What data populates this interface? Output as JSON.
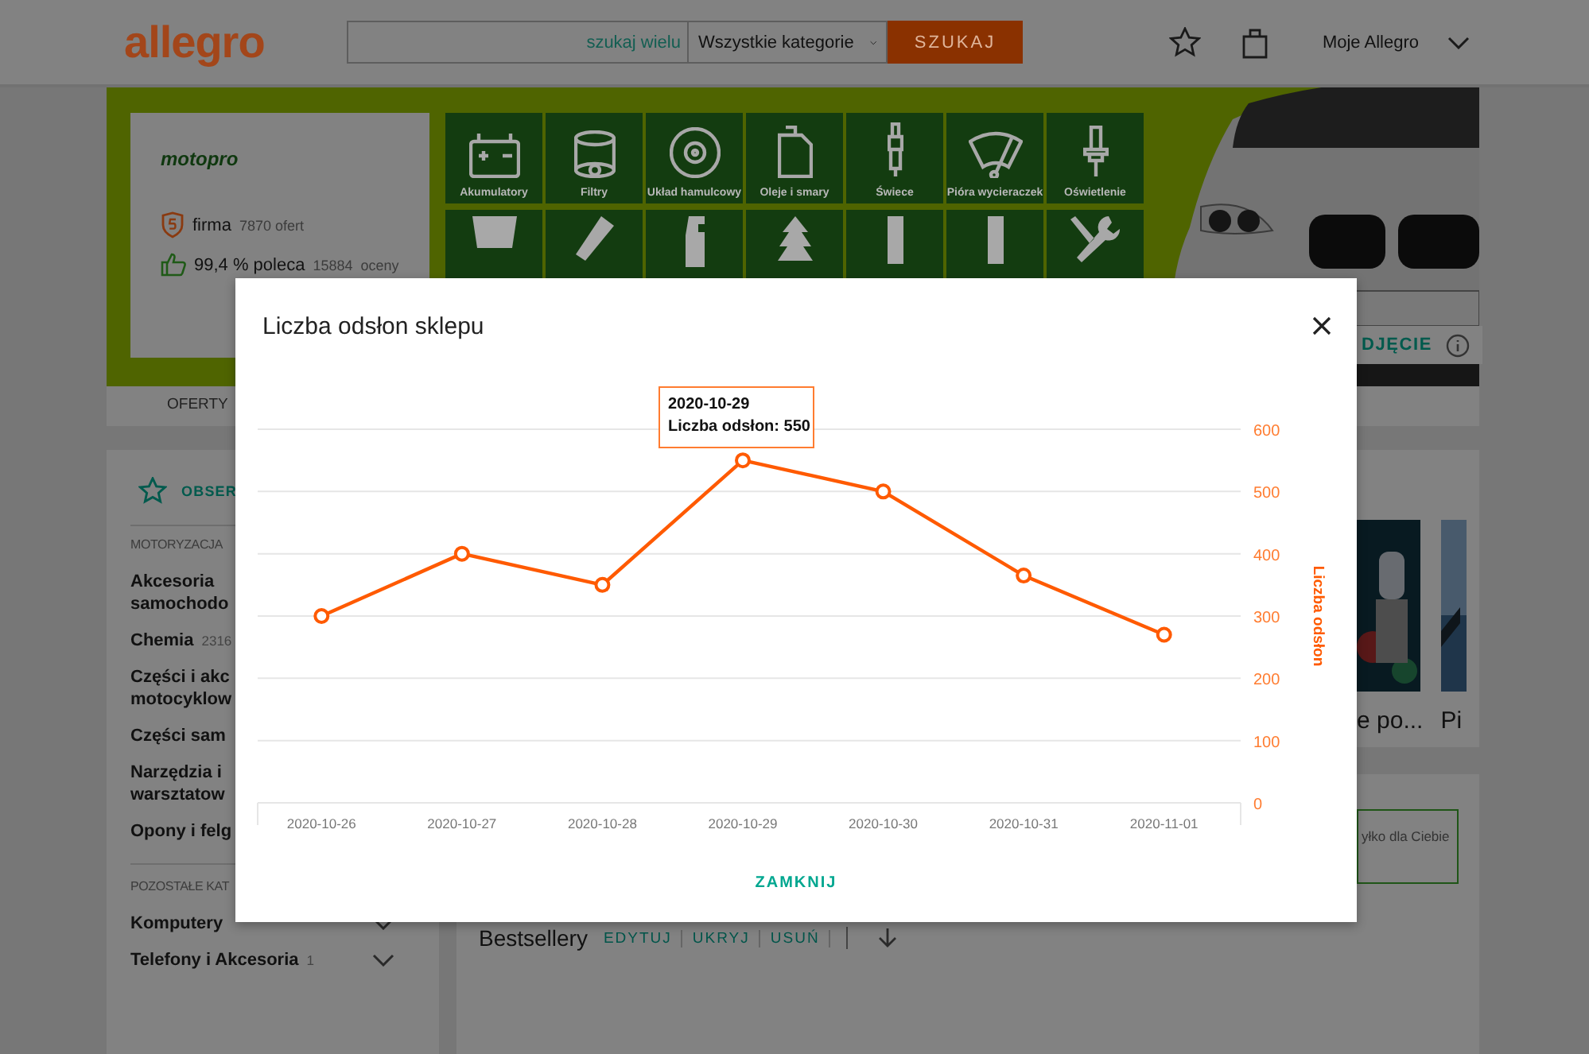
{
  "header": {
    "logo": "allegro",
    "search_link": "szukaj wielu",
    "category": "Wszystkie kategorie",
    "search_button": "SZUKAJ",
    "account": "Moje Allegro"
  },
  "shop": {
    "logo": "motopro",
    "type": "firma",
    "offers": "7870 ofert",
    "rating": "99,4 % poleca",
    "ratings_count": "15884",
    "ratings_label": "oceny",
    "photo_button": "DJĘCIE"
  },
  "categories": [
    {
      "label": "Akumulatory"
    },
    {
      "label": "Filtry"
    },
    {
      "label": "Układ hamulcowy"
    },
    {
      "label": "Oleje i smary"
    },
    {
      "label": "Świece"
    },
    {
      "label": "Pióra wycieraczek"
    },
    {
      "label": "Oświetlenie"
    }
  ],
  "tabs": [
    {
      "label": "OFERTY",
      "selected": false
    }
  ],
  "sidebar": {
    "follow": "OBSER",
    "groups": [
      {
        "heading": "MOTORYZACJA",
        "items": [
          {
            "label": "Akcesoria\nsamochodo"
          },
          {
            "label": "Chemia",
            "count": "2316"
          },
          {
            "label": "Części i akc\nmotocyklow"
          },
          {
            "label": "Części sam"
          },
          {
            "label": "Narzędzia i\nwarsztatow"
          },
          {
            "label": "Opony i felg"
          }
        ]
      },
      {
        "heading": "POZOSTAŁE KAT",
        "items": [
          {
            "label": "Komputery",
            "expanded": false
          },
          {
            "label": "Telefony i Akcesoria",
            "count": "1",
            "expanded": false
          }
        ]
      }
    ]
  },
  "products": [
    {
      "caption": "e po..."
    },
    {
      "caption": "Pi"
    }
  ],
  "promo": {
    "text": "yłko dla Ciebie"
  },
  "bestsellers": {
    "title": "Bestsellery",
    "actions": [
      "EDYTUJ",
      "UKRYJ",
      "USUŃ"
    ]
  },
  "modal": {
    "title": "Liczba odsłon sklepu",
    "close_button": "ZAMKNIJ",
    "tooltip": {
      "title": "2020-10-29",
      "text": "Liczba odsłon: 550"
    },
    "chart_data": {
      "type": "line",
      "ylabel": "Liczba odsłon",
      "grid": true,
      "categories": [
        "2020-10-26",
        "2020-10-27",
        "2020-10-28",
        "2020-10-29",
        "2020-10-30",
        "2020-10-31",
        "2020-11-01"
      ],
      "series": [
        {
          "color": "#ff5a00",
          "marker": "circle",
          "values": [
            300,
            400,
            350,
            550,
            500,
            365,
            270
          ]
        }
      ],
      "ylim": [
        0,
        600
      ],
      "yticks": [
        0,
        100,
        200,
        300,
        400,
        500,
        600
      ]
    }
  }
}
